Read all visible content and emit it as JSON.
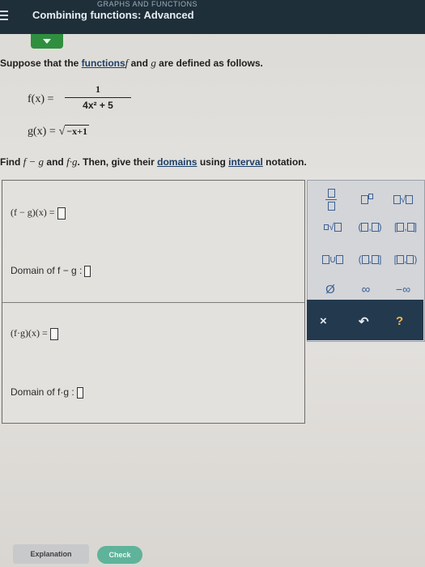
{
  "header": {
    "title": "Combining functions: Advanced",
    "subtitle": "GRAPHS AND FUNCTIONS"
  },
  "prompt": {
    "intro_prefix": "Suppose that the ",
    "intro_link": "functions",
    "intro_f": "f",
    "intro_and": " and ",
    "intro_g": "g",
    "intro_suffix": " are defined as follows.",
    "f_lhs": "f(x) =",
    "f_num": "1",
    "f_den": "4x² + 5",
    "g_lhs": "g(x) =",
    "g_rad": "−x+1",
    "find_prefix": "Find ",
    "find_fg_minus": "f − g",
    "find_and": " and ",
    "find_fg_prod": "f·g",
    "find_mid": ". Then, give their ",
    "find_link1": "domains",
    "find_using": " using ",
    "find_link2": "interval",
    "find_suffix": " notation."
  },
  "answers": {
    "diff_label": "(f − g)(x) =",
    "diff_domain_label": "Domain of  f − g  :",
    "prod_label": "(f·g)(x) =",
    "prod_domain_label": "Domain of  f·g  :"
  },
  "palette": {
    "empty_set": "Ø",
    "infinity": "∞",
    "neg_infinity": "−∞",
    "clear": "×",
    "undo": "↶",
    "help": "?"
  },
  "footer": {
    "explanation_label": "Explanation",
    "check_label": "Check"
  },
  "colors": {
    "topbar": "#1f2f3a",
    "tab_accent": "#2f8f3f",
    "palette_dark": "#23394e",
    "check": "#5eb39a"
  }
}
